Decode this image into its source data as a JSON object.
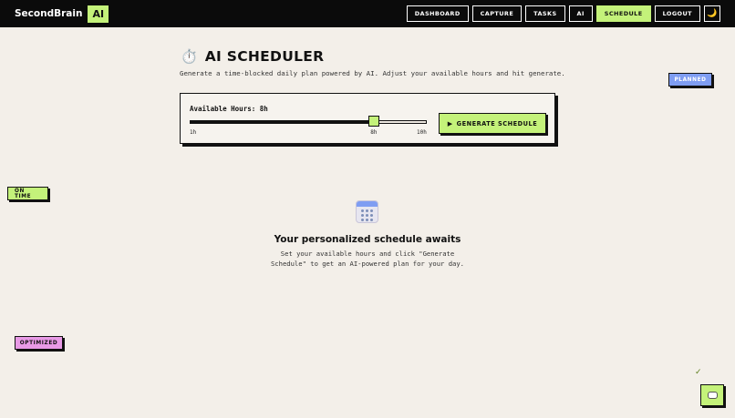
{
  "navbar": {
    "brand": "SecondBrain",
    "brand_badge": "AI",
    "links": [
      "DASHBOARD",
      "CAPTURE",
      "TASKS",
      "AI",
      "SCHEDULE",
      "LOGOUT"
    ],
    "active": "SCHEDULE",
    "theme_toggle_icon": "🌙"
  },
  "header": {
    "icon": "⏱️",
    "title": "AI SCHEDULER",
    "subtitle": "Generate a time-blocked daily plan powered by AI. Adjust your available hours and hit generate."
  },
  "scheduler": {
    "hours_label": "Available Hours: 8h",
    "slider": {
      "min": 1,
      "max": 10,
      "value": 8
    },
    "tick_min": "1h",
    "tick_mid": "8h",
    "tick_max": "10h",
    "generate_icon": "▶",
    "generate_label": "GENERATE SCHEDULE"
  },
  "empty_state": {
    "icon": "calendar-icon",
    "title": "Your personalized schedule awaits",
    "description": "Set your available hours and click \"Generate Schedule\" to get an AI-powered plan for your day."
  },
  "tags": {
    "planned": "PLANNED",
    "on_time": "ON TIME",
    "optimized": "OPTIMIZED"
  },
  "floating": {
    "check": "✓",
    "chat_icon": "chat-icon"
  },
  "colors": {
    "accent_green": "#c4f27a",
    "accent_blue": "#7f9df2",
    "accent_pink": "#e89ae6",
    "background": "#f3efe9",
    "navbar": "#0b0b0b"
  }
}
